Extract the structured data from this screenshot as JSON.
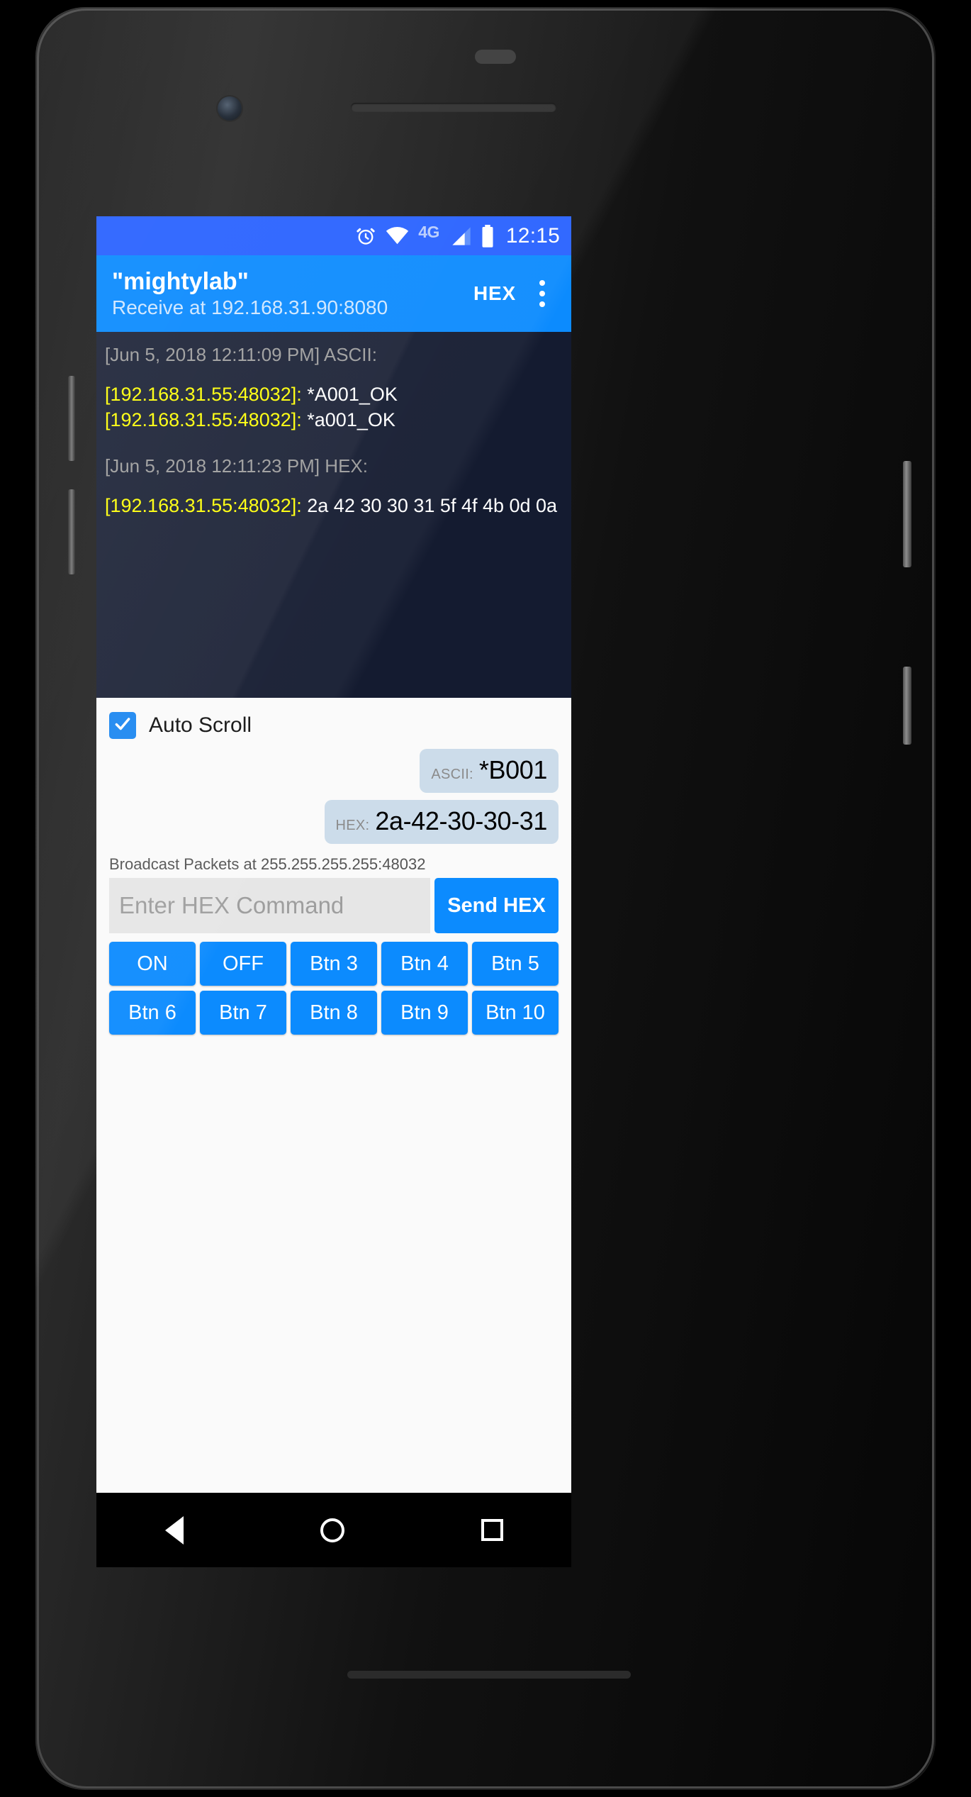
{
  "status_bar": {
    "alarm_icon": "alarm-clock-icon",
    "wifi_icon": "wifi-icon",
    "network_type": "4G",
    "signal_icon": "cellular-signal-icon",
    "battery_icon": "battery-full-icon",
    "clock": "12:15"
  },
  "app_bar": {
    "title": "\"mightylab\"",
    "subtitle": "Receive at 192.168.31.90:8080",
    "mode_button_label": "HEX",
    "overflow_icon": "more-vertical-icon"
  },
  "console": {
    "entries": [
      {
        "kind": "timestamp",
        "text": "[Jun 5, 2018 12:11:09 PM] ASCII:"
      },
      {
        "kind": "packet",
        "peer": "[192.168.31.55:48032]:",
        "payload": "*A001_OK"
      },
      {
        "kind": "packet",
        "peer": "[192.168.31.55:48032]:",
        "payload": "*a001_OK"
      },
      {
        "kind": "timestamp",
        "text": "[Jun 5, 2018 12:11:23 PM] HEX:"
      },
      {
        "kind": "packet",
        "peer": "[192.168.31.55:48032]:",
        "payload": "2a 42 30 30 31 5f 4f 4b 0d 0a"
      }
    ]
  },
  "auto_scroll": {
    "label": "Auto Scroll",
    "checked": true,
    "check_icon": "checkmark-icon"
  },
  "previews": [
    {
      "kind": "ASCII:",
      "value": "*B001"
    },
    {
      "kind": "HEX:",
      "value": "2a-42-30-30-31"
    }
  ],
  "broadcast": {
    "label": "Broadcast Packets at 255.255.255.255:48032"
  },
  "send": {
    "input_value": "",
    "input_placeholder": "Enter HEX Command",
    "button_label": "Send HEX"
  },
  "presets": [
    {
      "label": "ON"
    },
    {
      "label": "OFF"
    },
    {
      "label": "Btn 3"
    },
    {
      "label": "Btn 4"
    },
    {
      "label": "Btn 5"
    },
    {
      "label": "Btn 6"
    },
    {
      "label": "Btn 7"
    },
    {
      "label": "Btn 8"
    },
    {
      "label": "Btn 9"
    },
    {
      "label": "Btn 10"
    }
  ],
  "nav_bar": {
    "back_icon": "back-triangle-icon",
    "home_icon": "home-circle-icon",
    "recents_icon": "recents-square-icon"
  },
  "colors": {
    "accent_blue": "#0c8bfe",
    "status_blue": "#2962ff",
    "console_bg": "#141b30",
    "peer_yellow": "#ffff00",
    "chip_bg": "#ccdcea"
  }
}
